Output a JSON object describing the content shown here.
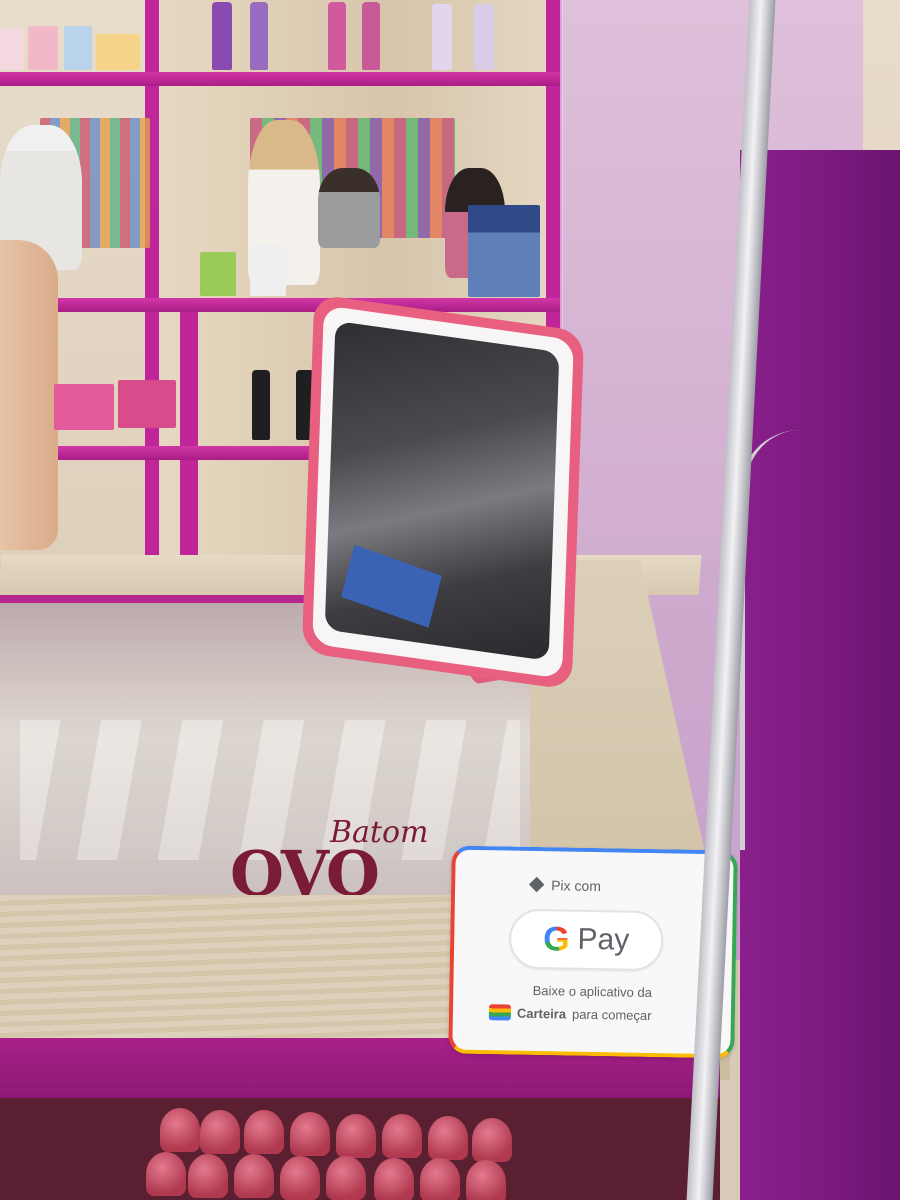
{
  "sticker": {
    "line1": "Pix com",
    "g_letter": "G",
    "pay_word": "Pay",
    "line2": "Baixe o aplicativo da",
    "wallet_bold": "Carteira",
    "wallet_rest": "para começar",
    "icons": [
      "pix-icon",
      "google-g-icon",
      "wallet-icon"
    ],
    "border_colors": [
      "#4285f4",
      "#34a853",
      "#fbbc05",
      "#ea4335"
    ]
  },
  "logo": {
    "script": "Batom",
    "big": "OVO"
  },
  "colors": {
    "shelf_magenta": "#c0259a",
    "mirror_pink": "#e85f80",
    "pillar_purple": "#7a1a7e",
    "counter_wood": "#dccfb9"
  }
}
